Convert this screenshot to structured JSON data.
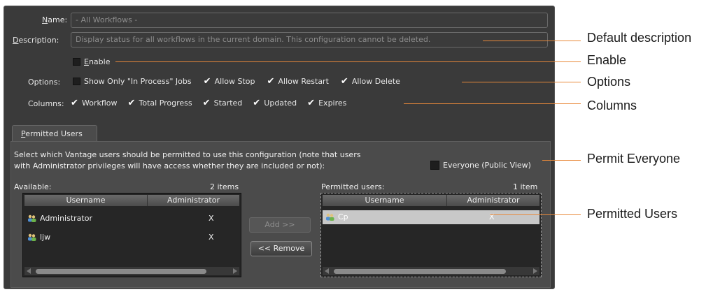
{
  "form": {
    "name_label": "Name:",
    "name_value": "- All Workflows -",
    "description_label": "Description:",
    "description_value": "Display status for all workflows in the current domain. This configuration cannot be deleted.",
    "enable_label": "Enable",
    "enable_checked": false,
    "options_label": "Options:",
    "options": [
      {
        "label": "Show Only \"In Process\" Jobs",
        "checked": false
      },
      {
        "label": "Allow Stop",
        "checked": true
      },
      {
        "label": "Allow Restart",
        "checked": true
      },
      {
        "label": "Allow Delete",
        "checked": true
      }
    ],
    "columns_label": "Columns:",
    "columns": [
      {
        "label": "Workflow",
        "checked": true
      },
      {
        "label": "Total Progress",
        "checked": true
      },
      {
        "label": "Started",
        "checked": true
      },
      {
        "label": "Updated",
        "checked": true
      },
      {
        "label": "Expires",
        "checked": true
      }
    ]
  },
  "permitted_tab": {
    "tab_label": "Permitted Users",
    "instructions_line1": "Select which Vantage users should be permitted to use this configuration (note that users",
    "instructions_line2": "with Administrator privileges will have access whether they are included or not):",
    "everyone_label": "Everyone (Public View)",
    "everyone_checked": false,
    "available": {
      "label": "Available:",
      "count": "2 items",
      "col_username": "Username",
      "col_admin": "Administrator",
      "rows": [
        {
          "username": "Administrator",
          "admin": "X"
        },
        {
          "username": "ljw",
          "admin": "X"
        }
      ]
    },
    "permitted": {
      "label": "Permitted users:",
      "count": "1 item",
      "col_username": "Username",
      "col_admin": "Administrator",
      "rows": [
        {
          "username": "Cp",
          "admin": "X",
          "selected": true
        }
      ]
    },
    "add_button": "Add >>",
    "remove_button": "<< Remove"
  },
  "callouts": {
    "default_description": "Default description",
    "enable": "Enable",
    "options": "Options",
    "columns": "Columns",
    "permit_everyone": "Permit Everyone",
    "permitted_users": "Permitted Users"
  },
  "colors": {
    "panel_bg": "#3a3a3a",
    "callout_line": "#e8893a",
    "selected_row": "#c8c8c8"
  },
  "icons": {
    "checkbox_checked": "check-mark",
    "user": "user-group-icon"
  }
}
